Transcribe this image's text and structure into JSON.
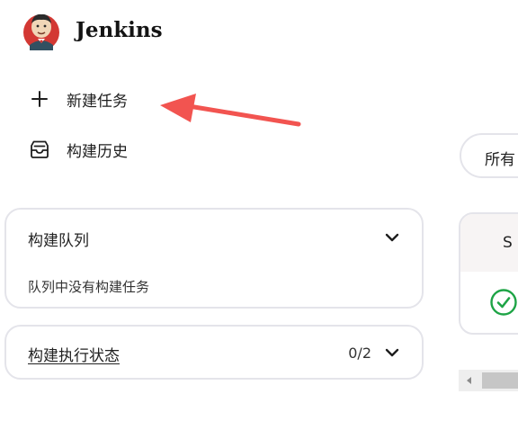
{
  "header": {
    "brand": "Jenkins"
  },
  "nav": {
    "new_item": "新建任务",
    "build_history": "构建历史"
  },
  "build_queue": {
    "title": "构建队列",
    "empty_text": "队列中没有构建任务"
  },
  "executor_status": {
    "title": "构建执行状态",
    "count": "0/2"
  },
  "view_filter": {
    "label": "所有"
  },
  "job_table": {
    "header_partial": "S"
  },
  "colors": {
    "arrow": "#f25450",
    "success": "#1ea446",
    "border": "#e4e4ea"
  }
}
